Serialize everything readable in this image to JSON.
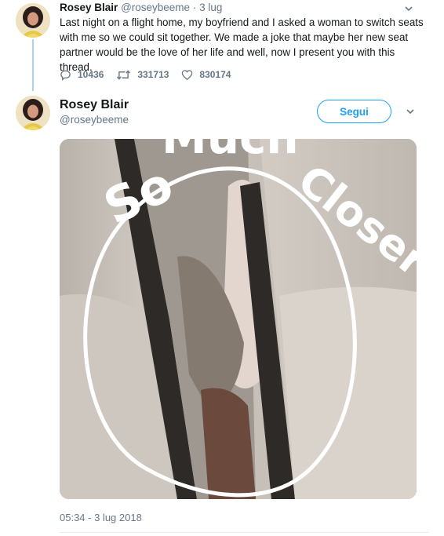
{
  "tweet_parent": {
    "author_name": "Rosey Blair",
    "author_handle": "@roseybeeme",
    "separator": " · ",
    "date": "3 lug",
    "text": "Last night on a flight home, my boyfriend and I asked a woman to switch seats with me so we could sit together. We made a joke that maybe her new seat partner would be the love of her life and well, now I present you with this thread.",
    "replies": "10436",
    "retweets": "331713",
    "likes": "830174"
  },
  "tweet_main": {
    "author_name": "Rosey Blair",
    "author_handle": "@roseybeeme",
    "follow_label": "Segui",
    "photo_overlay_words": [
      "So",
      "Much",
      "Closer"
    ],
    "timestamp": "05:34 - 3 lug 2018"
  },
  "colors": {
    "accent": "#1da1f2",
    "thread_line": "#a8d4f2",
    "muted_text": "#657786"
  },
  "icons": {
    "reply": "reply-icon",
    "retweet": "retweet-icon",
    "like": "heart-icon",
    "more": "chevron-down-icon"
  }
}
